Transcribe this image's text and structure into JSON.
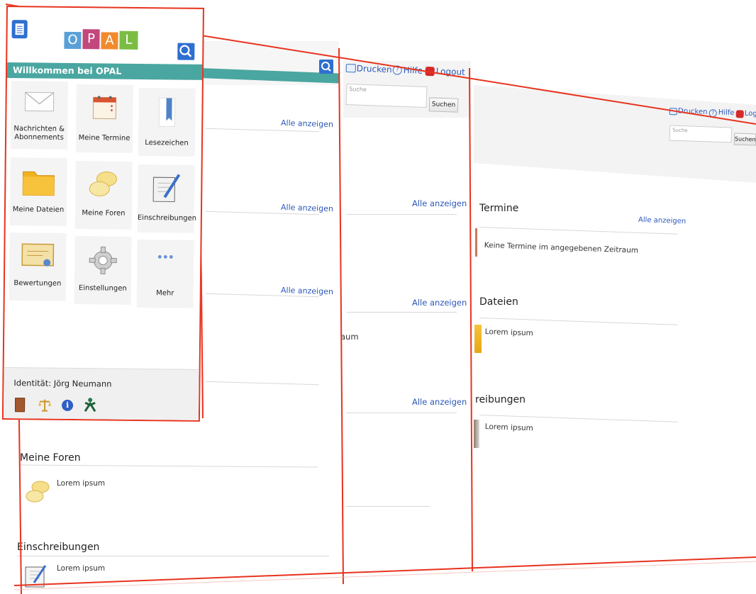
{
  "panel": {
    "logo_letters": [
      "O",
      "P",
      "A",
      "L"
    ],
    "welcome": "Willkommen bei OPAL",
    "tiles": [
      {
        "label": "Nachrichten &\nAbonnements",
        "icon": "envelope-icon"
      },
      {
        "label": "Meine Termine",
        "icon": "calendar-icon"
      },
      {
        "label": "Lesezeichen",
        "icon": "bookmark-icon"
      },
      {
        "label": "Meine Dateien",
        "icon": "folder-icon"
      },
      {
        "label": "Meine Foren",
        "icon": "speech-bubbles-icon"
      },
      {
        "label": "Einschreibungen",
        "icon": "notebook-pen-icon"
      },
      {
        "label": "Bewertungen",
        "icon": "certificate-icon"
      },
      {
        "label": "Einstellungen",
        "icon": "gear-icon"
      },
      {
        "label": "Mehr",
        "icon": "more-dots-icon"
      }
    ],
    "identity": "Identität: Jörg Neumann"
  },
  "toolbar": {
    "print": "Drucken",
    "help": "Hilfe",
    "logout": "Logout",
    "search_placeholder": "Suche",
    "search_button": "Suchen"
  },
  "links": {
    "show_all": "Alle anzeigen"
  },
  "sections": {
    "termine": "Termine",
    "termine_empty": "Keine Termine im angegebenen Zeitraum",
    "dateien": "Dateien",
    "dateien_item": "Lorem ipsum",
    "einschreibungen_partial": "reibungen",
    "einschreibungen_item": "Lorem ipsum",
    "raum_partial": "aum",
    "foren": "Meine Foren",
    "foren_item": "Lorem ipsum",
    "einschreibungen": "Einschreibungen",
    "einschreibungen_item2": "Lorem ipsum"
  },
  "colors": {
    "accent_red": "#e8331e",
    "header_teal": "#4aa6a0",
    "link_blue": "#2b57b8"
  }
}
